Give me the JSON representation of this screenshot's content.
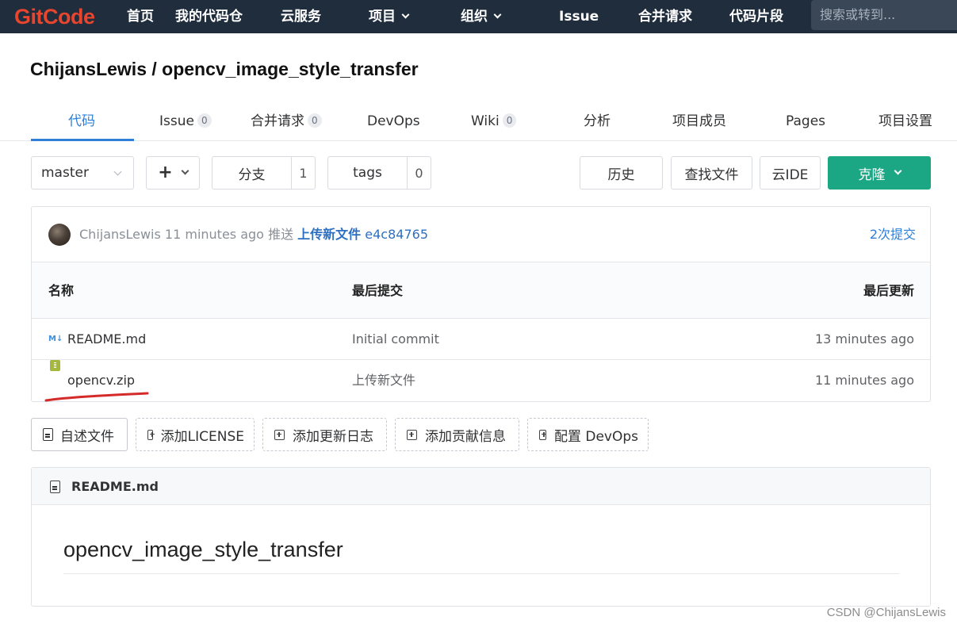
{
  "navbar": {
    "logo": "GitCode",
    "items": [
      "首页",
      "我的代码仓",
      "云服务",
      "项目",
      "组织",
      "Issue",
      "合并请求",
      "代码片段"
    ],
    "search_placeholder": "搜索或转到..."
  },
  "repo": {
    "title": "ChijansLewis / opencv_image_style_transfer"
  },
  "tabs": [
    {
      "label": "代码"
    },
    {
      "label": "Issue",
      "count": "0"
    },
    {
      "label": "合并请求",
      "count": "0"
    },
    {
      "label": "DevOps"
    },
    {
      "label": "Wiki",
      "count": "0"
    },
    {
      "label": "分析"
    },
    {
      "label": "项目成员"
    },
    {
      "label": "Pages"
    },
    {
      "label": "项目设置"
    }
  ],
  "toolbar": {
    "branch": "master",
    "plus": "+",
    "branches_label": "分支",
    "branches_count": "1",
    "tags_label": "tags",
    "tags_count": "0",
    "history": "历史",
    "find_file": "查找文件",
    "web_ide": "云IDE",
    "clone": "克隆"
  },
  "last_commit": {
    "author": "ChijansLewis",
    "time": "11 minutes ago",
    "action": "推送",
    "message": "上传新文件",
    "sha": "e4c84765",
    "commit_count": "2次提交"
  },
  "files": {
    "headers": {
      "name": "名称",
      "last_commit": "最后提交",
      "last_update": "最后更新"
    },
    "rows": [
      {
        "icon": "markdown-icon",
        "name": "README.md",
        "commit": "Initial commit",
        "updated": "13 minutes ago"
      },
      {
        "icon": "zip-icon",
        "name": "opencv.zip",
        "commit": "上传新文件",
        "updated": "11 minutes ago"
      }
    ]
  },
  "actions": {
    "readme": "自述文件",
    "license": "添加LICENSE",
    "changelog": "添加更新日志",
    "contributing": "添加贡献信息",
    "devops": "配置 DevOps"
  },
  "readme": {
    "filename": "README.md",
    "heading": "opencv_image_style_transfer"
  },
  "watermark": "CSDN @ChijansLewis",
  "colors": {
    "navbar_bg": "#1f2d3d",
    "logo": "#e8452f",
    "accent": "#2f7fd8",
    "clone_bg": "#1ba784",
    "annotation": "#d42a2a"
  }
}
